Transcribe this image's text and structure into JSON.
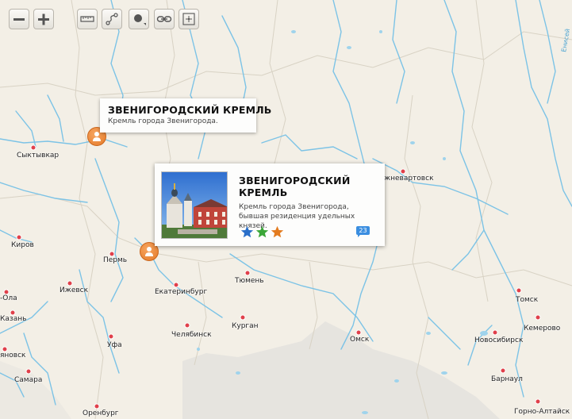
{
  "toolbar": {
    "buttons": [
      {
        "icon": "zoom-out-icon"
      },
      {
        "icon": "zoom-in-icon"
      },
      {
        "icon": "ruler-icon"
      },
      {
        "icon": "route-icon"
      },
      {
        "icon": "point-icon"
      },
      {
        "icon": "link-icon"
      },
      {
        "icon": "crosshair-icon"
      }
    ]
  },
  "cities": {
    "syktyvkar": "Сыктывкар",
    "kirov": "Киров",
    "perm": "Пермь",
    "izhevsk": "Ижевск",
    "yoshkar_ola": "-Ола",
    "kazan": "Казань",
    "ulyanovsk": "яновск",
    "samara": "Самара",
    "ufa": "Уфа",
    "orenburg": "Оренбург",
    "chelyabinsk": "Челябинск",
    "ekaterinburg": "Екатеринбург",
    "tyumen": "Тюмень",
    "kurgan": "Курган",
    "omsk": "Омск",
    "nizhnevartovsk": "жневартовск",
    "tomsk": "Томск",
    "kemerovo": "Кемерово",
    "novosibirsk": "Новосибирск",
    "barnaul": "Барнаул",
    "gorno_altaisk": "Горно-Алтайск"
  },
  "river_label": "Енисей",
  "popup_small": {
    "title": "ЗВЕНИГОРОДСКИЙ КРЕМЛЬ",
    "description": "Кремль города Звенигорода."
  },
  "popup_large": {
    "title": "ЗВЕНИГОРОДСКИЙ КРЕМЛЬ",
    "description": "Кремль города Звенигорода, бывшая резиденция удельных князей.",
    "rating_colors": [
      "#2a6fc9",
      "#3aa637",
      "#e37b1f"
    ],
    "comments_count": "23"
  },
  "colors": {
    "land": "#f3efe6",
    "water": "#7cc3e6",
    "marker": "#e8842e",
    "city_dot": "#e0404a"
  }
}
